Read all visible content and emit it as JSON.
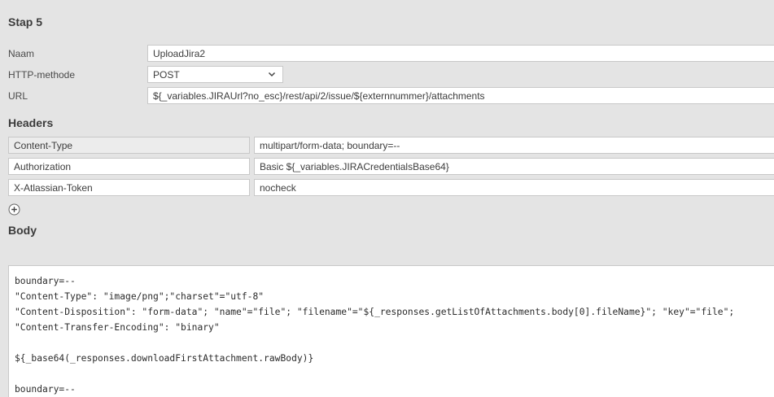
{
  "step": {
    "title": "Stap 5"
  },
  "form": {
    "name_label": "Naam",
    "name_value": "UploadJira2",
    "method_label": "HTTP-methode",
    "method_value": "POST",
    "url_label": "URL",
    "url_value": "${_variables.JIRAUrl?no_esc}/rest/api/2/issue/${externnummer}/attachments"
  },
  "headers": {
    "title": "Headers",
    "rows": [
      {
        "key": "Content-Type",
        "value": "multipart/form-data; boundary=--"
      },
      {
        "key": "Authorization",
        "value": "Basic ${_variables.JIRACredentialsBase64}"
      },
      {
        "key": "X-Atlassian-Token",
        "value": "nocheck"
      }
    ]
  },
  "body": {
    "title": "Body",
    "lines": [
      "boundary=--",
      "\"Content-Type\": \"image/png\";\"charset\"=\"utf-8\"",
      "\"Content-Disposition\": \"form-data\"; \"name\"=\"file\"; \"filename\"=\"${_responses.getListOfAttachments.body[0].fileName}\"; \"key\"=\"file\";",
      "\"Content-Transfer-Encoding\": \"binary\"",
      "",
      "${_base64(_responses.downloadFirstAttachment.rawBody)}",
      "",
      "boundary=--"
    ]
  },
  "icons": {
    "add": "plus-circle-icon",
    "dropdown": "chevron-down-icon"
  },
  "colors": {
    "background": "#e4e4e4",
    "input_border": "#c8c8c8",
    "readonly_input": "#ececec"
  }
}
